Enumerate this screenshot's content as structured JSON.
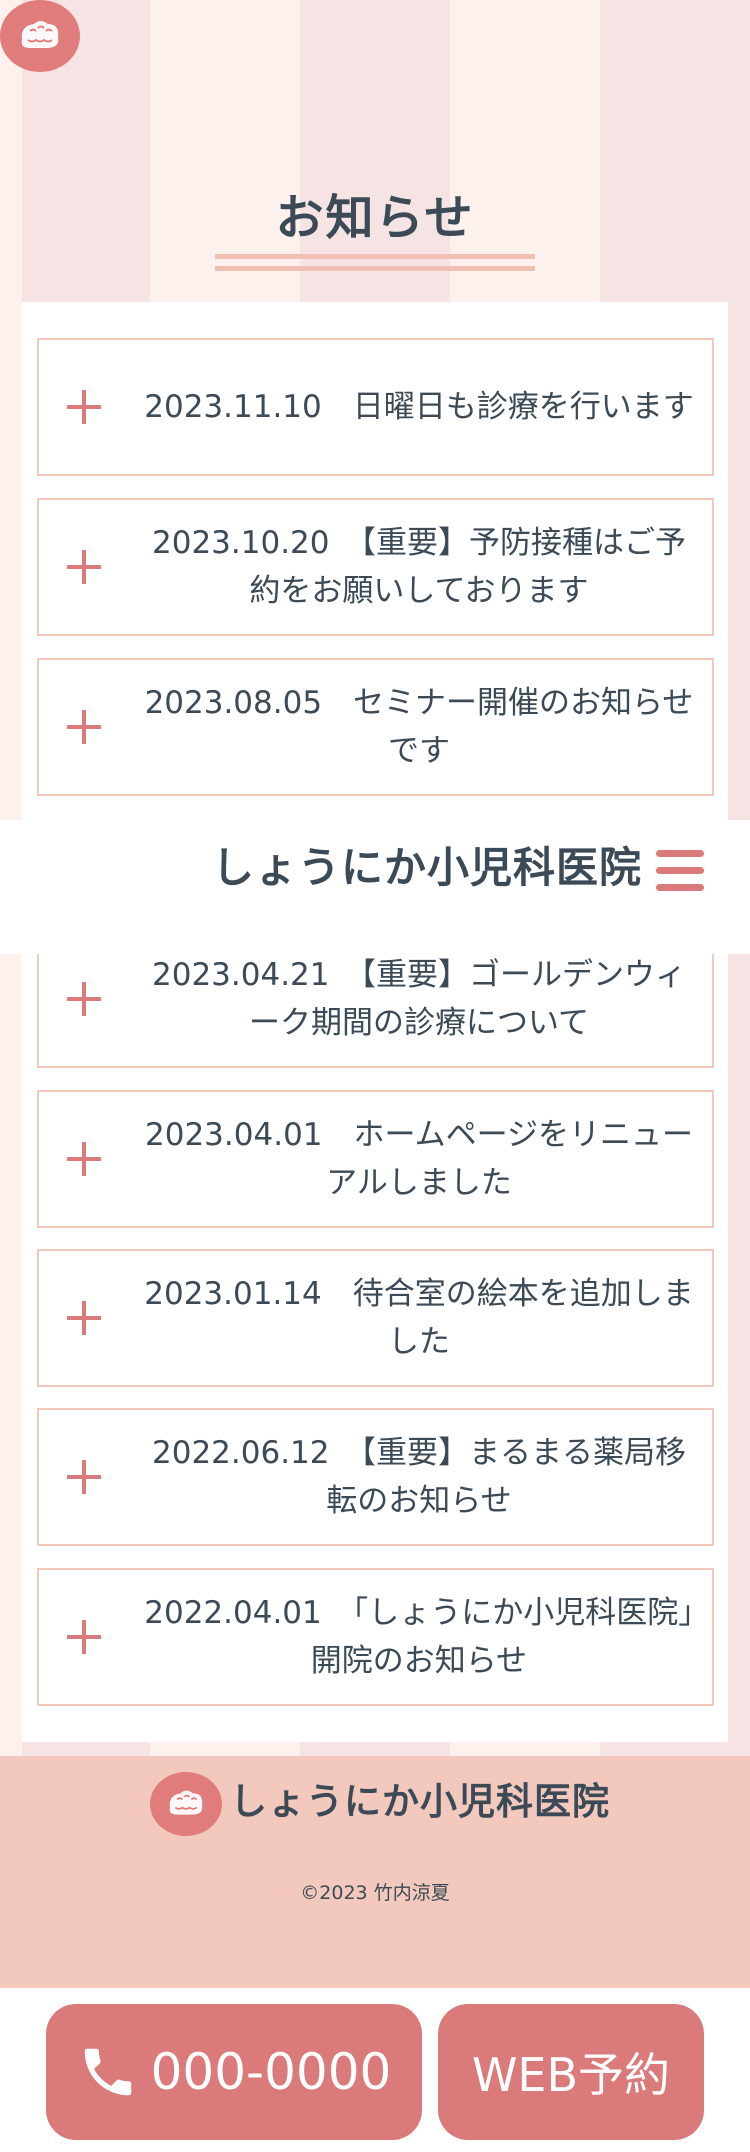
{
  "section": {
    "title": "お知らせ"
  },
  "news": [
    {
      "text": "2023.11.10　日曜日も診療を行います"
    },
    {
      "text": "2023.10.20　【重要】予防接種はご予約をお願いしております"
    },
    {
      "text": "2023.08.05　セミナー開催のお知らせです"
    },
    {
      "text": "2023.04.21　【重要】ゴールデンウィーク期間の診療について"
    },
    {
      "text": "2023.04.01　ホームページをリニューアルしました"
    },
    {
      "text": "2023.01.14　待合室の絵本を追加しました"
    },
    {
      "text": "2022.06.12　【重要】まるまる薬局移転のお知らせ"
    },
    {
      "text": "2022.04.01　「しょうにか小児科医院」開院のお知らせ"
    }
  ],
  "header": {
    "clinic_name": "しょうにか小児科医院",
    "logo_icon": "clinic-face-logo-icon",
    "menu_icon": "hamburger-menu-icon"
  },
  "footer": {
    "clinic_name": "しょうにか小児科医院",
    "copyright": "©2023 竹内涼夏"
  },
  "cta": {
    "phone_label": "000-0000",
    "phone_icon": "phone-icon",
    "web_label": "WEB予約"
  },
  "colors": {
    "accent": "#db7a7a",
    "text": "#3b4a56",
    "footer_bg": "#f2c9bc",
    "item_border": "#f2c7bc"
  }
}
